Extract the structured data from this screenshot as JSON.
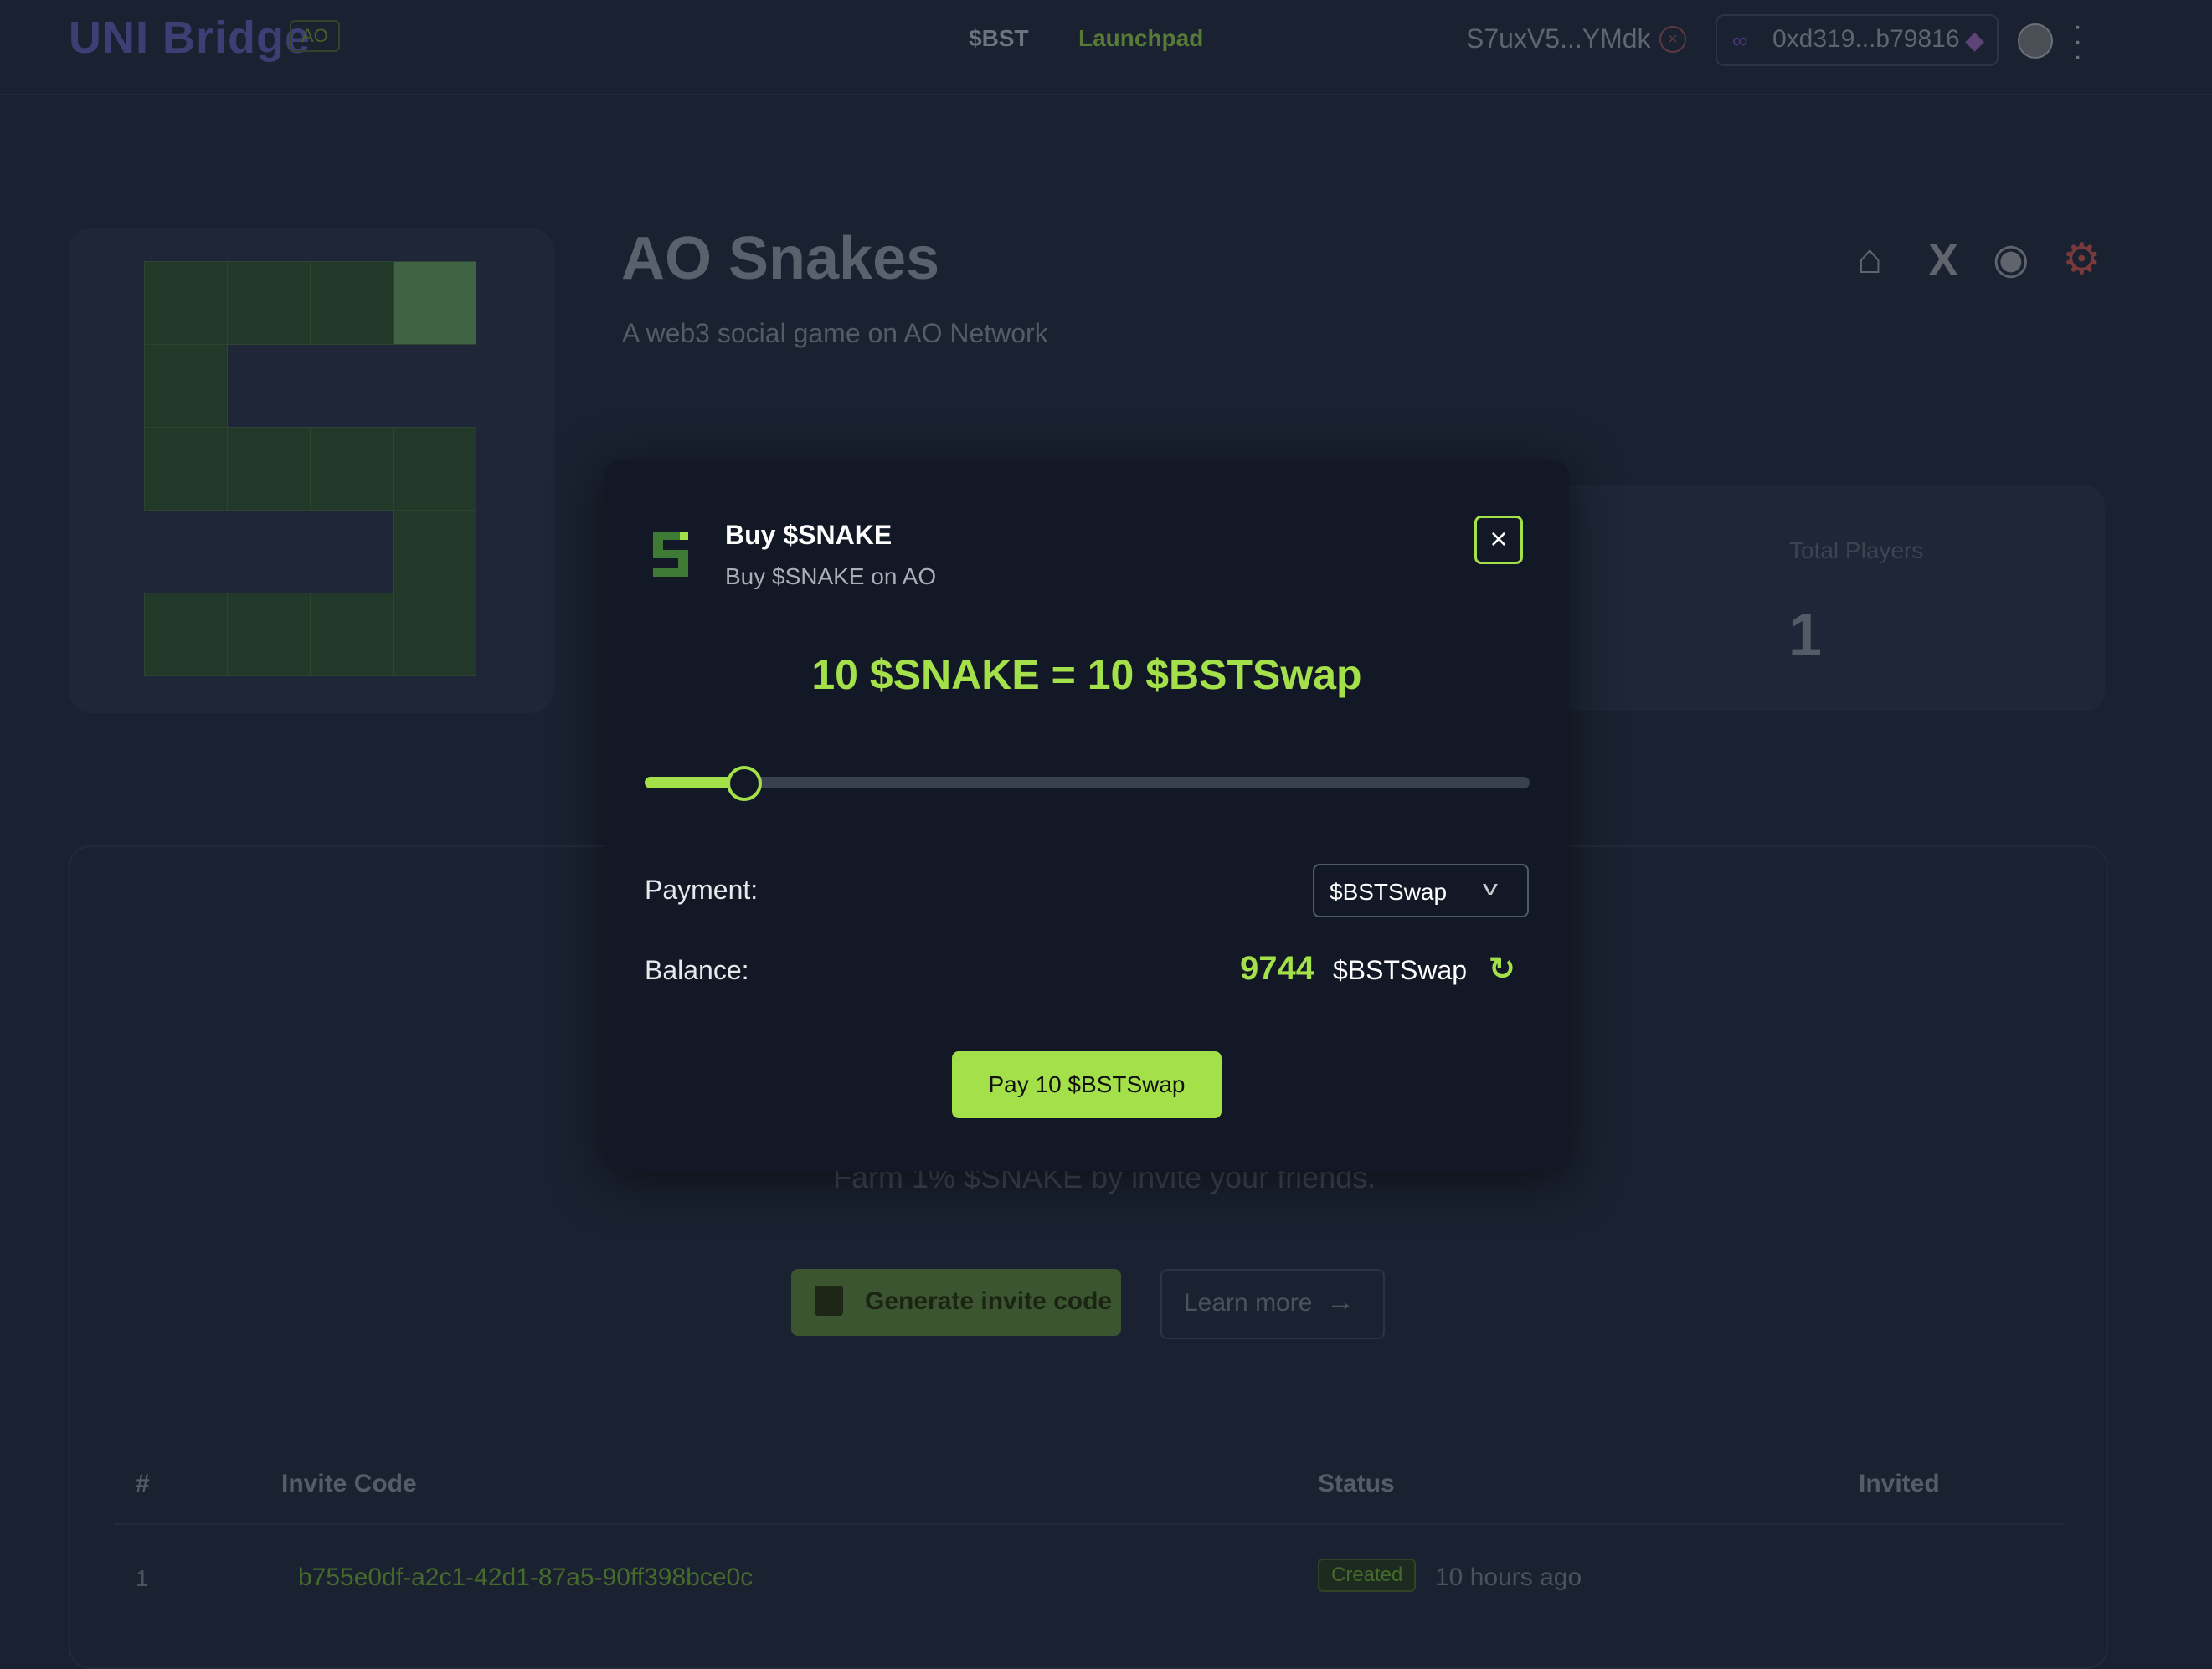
{
  "header": {
    "brand": "UNI Bridge",
    "brand_badge": "AO",
    "nav": [
      "$BST",
      "Launchpad"
    ],
    "wallet_ar": "S7uxV5...YMdk",
    "wallet_evm": "0xd319...b79816",
    "icons": {
      "disconnect": "close-circle-icon",
      "chain": "link-icon",
      "wallet": "metamask-fox-icon",
      "avatar": "avatar",
      "menu": "kebab-menu-icon"
    }
  },
  "game": {
    "title": "AO Snakes",
    "description": "A web3 social game on AO Network",
    "social_icons": [
      "home-icon",
      "x-icon",
      "discord-icon",
      "gear-icon"
    ]
  },
  "stats": {
    "label": "Total Players",
    "value": "1"
  },
  "invite": {
    "farm_text": "Farm 1% $SNAKE by invite your friends.",
    "generate_button": "Generate invite code",
    "learn_more_button": "Learn more",
    "table": {
      "columns": [
        "#",
        "Invite Code",
        "Status",
        "Invited"
      ],
      "rows": [
        {
          "num": "1",
          "code": "b755e0df-a2c1-42d1-87a5-90ff398bce0c",
          "status": "Created",
          "time": "10 hours ago",
          "invited": ""
        }
      ]
    }
  },
  "modal": {
    "title": "Buy $SNAKE",
    "subtitle": "Buy $SNAKE on AO",
    "rate": "10 $SNAKE = 10 $BSTSwap",
    "slider_fraction": 0.112,
    "payment_label": "Payment:",
    "payment_value": "$BSTSwap",
    "balance_label": "Balance:",
    "balance_value": "9744",
    "balance_unit": "$BSTSwap",
    "pay_button": "Pay 10 $BSTSwap"
  },
  "colors": {
    "accent": "#a3e04a",
    "modal_bg": "#121825",
    "page_bg": "#1a2130"
  }
}
